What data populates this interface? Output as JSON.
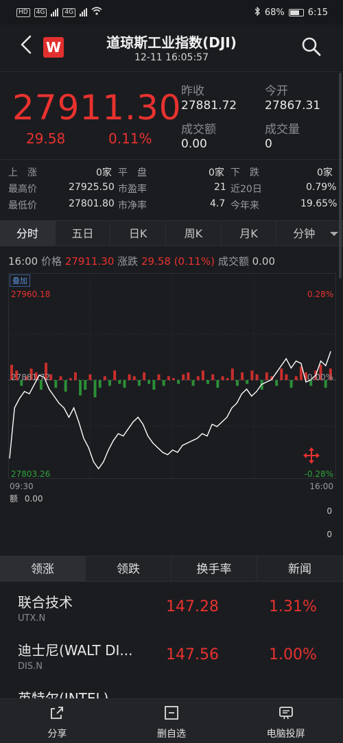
{
  "status_bar": {
    "net1": "HD",
    "net2": "4G",
    "net3": "4G",
    "battery": "68%",
    "time": "6:15"
  },
  "header": {
    "logo_letter": "W",
    "title": "道琼斯工业指数(DJI)",
    "subtitle": "12-11 16:05:57"
  },
  "quote": {
    "price": "27911.30",
    "change": "29.58",
    "change_pct": "0.11%",
    "prev_close_label": "昨收",
    "prev_close": "27881.72",
    "open_label": "今开",
    "open": "27867.31",
    "turnover_label": "成交额",
    "turnover": "0.00",
    "volume_label": "成交量",
    "volume": "0"
  },
  "stats": {
    "up_label": "上　涨",
    "up_value": "0家",
    "flat_label": "平　盘",
    "flat_value": "0家",
    "down_label": "下　跌",
    "down_value": "0家",
    "high_label": "最高价",
    "high_value": "27925.50",
    "pe_label": "市盈率",
    "pe_value": "21",
    "d20_label": "近20日",
    "d20_value": "0.79%",
    "low_label": "最低价",
    "low_value": "27801.80",
    "pb_label": "市净率",
    "pb_value": "4.7",
    "ytd_label": "今年来",
    "ytd_value": "19.65%"
  },
  "chart_tabs": [
    "分时",
    "五日",
    "日K",
    "周K",
    "月K",
    "分钟"
  ],
  "info_line": {
    "time": "16:00",
    "price_label": "价格",
    "price": "27911.30",
    "chg_label": "涨跌",
    "chg": "29.58 (0.11%)",
    "amount_label": "成交额",
    "amount": "0.00"
  },
  "chart_labels": {
    "overlay": "叠加",
    "top_price": "27960.18",
    "top_pct": "0.28%",
    "mid_price": "27881.72",
    "mid_pct": "0.00%",
    "bottom_price": "27803.26",
    "bottom_pct": "-0.28%",
    "start_time": "09:30",
    "end_time": "16:00",
    "volume_label": "额",
    "volume_value": "0.00",
    "vol_axis_a": "0",
    "vol_axis_b": "0"
  },
  "chart_data": {
    "type": "line",
    "ylim": [
      27803.26,
      27960.18
    ],
    "baseline": 27881.72,
    "x_start": "09:30",
    "x_end": "16:00",
    "values": [
      27815,
      27858,
      27866,
      27872,
      27870,
      27878,
      27886,
      27884,
      27874,
      27868,
      27862,
      27858,
      27850,
      27858,
      27846,
      27832,
      27824,
      27812,
      27806,
      27812,
      27822,
      27830,
      27836,
      27834,
      27840,
      27846,
      27850,
      27844,
      27834,
      27828,
      27824,
      27820,
      27818,
      27822,
      27820,
      27826,
      27828,
      27830,
      27832,
      27836,
      27834,
      27844,
      27842,
      27846,
      27850,
      27858,
      27862,
      27870,
      27874,
      27868,
      27872,
      27878,
      27880,
      27882,
      27888,
      27894,
      27900,
      27892,
      27898,
      27896,
      27880,
      27882,
      27886,
      27898,
      27894,
      27906
    ],
    "bars": [
      0.8,
      0.5,
      -0.3,
      0.2,
      0.6,
      0.4,
      -0.5,
      0.9,
      0.3,
      -0.4,
      0.2,
      -0.6,
      0.1,
      0.4,
      -0.8,
      -0.5,
      0.3,
      -0.9,
      -0.4,
      0.2,
      -0.3,
      0.5,
      -0.2,
      -0.4,
      0.3,
      0.2,
      -0.3,
      0.4,
      -0.2,
      -0.5,
      0.3,
      -0.3,
      0.2,
      0.1,
      -0.2,
      0.3,
      0.4,
      -0.3,
      0.2,
      0.5,
      -0.2,
      0.3,
      -0.4,
      0.2,
      0.1,
      0.6,
      -0.3,
      0.4,
      -0.2,
      0.5,
      0.3,
      -0.5,
      0.4,
      0.2,
      -0.3,
      0.6,
      0.3,
      -0.4,
      0.2,
      0.7,
      0.4,
      -0.3,
      0.5,
      0.8,
      -0.4,
      0.6
    ]
  },
  "ranking_tabs": [
    "领涨",
    "领跌",
    "换手率",
    "新闻"
  ],
  "stocks": [
    {
      "name": "联合技术",
      "code": "UTX.N",
      "price": "147.28",
      "pct": "1.31%"
    },
    {
      "name": "迪士尼(WALT DI...",
      "code": "DIS.N",
      "price": "147.56",
      "pct": "1.00%"
    },
    {
      "name": "英特尔(INTEL)",
      "code": "",
      "price": "",
      "pct": ""
    }
  ],
  "bottom_bar": {
    "share": "分享",
    "remove": "删自选",
    "cast": "电脑投屏"
  },
  "colors": {
    "up": "#e8322f",
    "down": "#2fa33b",
    "line": "#ffffff",
    "background": "#1b1c20"
  }
}
